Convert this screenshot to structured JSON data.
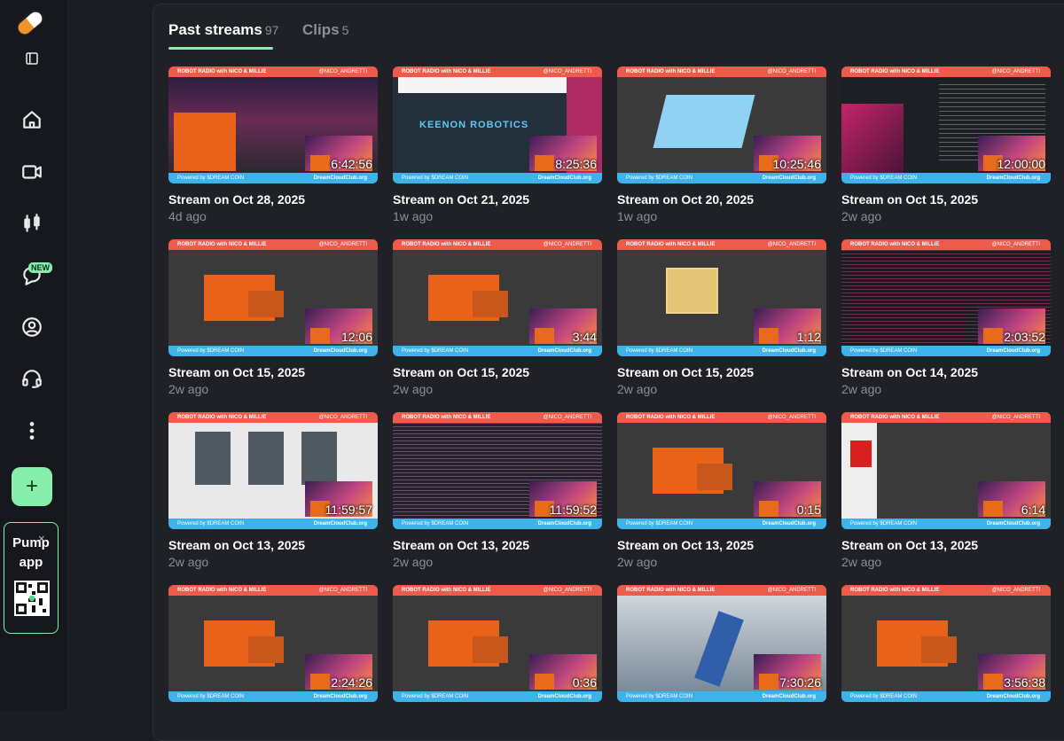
{
  "sidebar": {
    "items": [
      {
        "name": "sidebar-toggle-icon"
      },
      {
        "name": "home-icon"
      },
      {
        "name": "video-camera-icon"
      },
      {
        "name": "candlestick-icon"
      },
      {
        "name": "chat-icon",
        "badge": "NEW"
      },
      {
        "name": "profile-icon"
      },
      {
        "name": "headset-icon"
      },
      {
        "name": "more-icon"
      }
    ],
    "new_badge": "NEW",
    "plus_label": "+",
    "pump_app": {
      "line1": "Pump",
      "line2": "app",
      "close": "×"
    }
  },
  "tabs": [
    {
      "label": "Past streams",
      "count": "97",
      "active": true
    },
    {
      "label": "Clips",
      "count": "5",
      "active": false
    }
  ],
  "banner": {
    "top_left": "ROBOT RADIO with NICO & MILLIE",
    "top_right": "@NICO_ANDRETTI",
    "bottom_left": "Powered by $DREAM COIN",
    "bottom_right": "DreamCloudClub.org"
  },
  "streams": [
    {
      "title": "Stream on Oct 28, 2025",
      "age": "4d ago",
      "duration": "6:42:56",
      "scene": "studio"
    },
    {
      "title": "Stream on Oct 21, 2025",
      "age": "1w ago",
      "duration": "8:25:36",
      "scene": "web",
      "scene_text": "KEENON ROBOTICS"
    },
    {
      "title": "Stream on Oct 20, 2025",
      "age": "1w ago",
      "duration": "10:25:46",
      "scene": "cad"
    },
    {
      "title": "Stream on Oct 15, 2025",
      "age": "2w ago",
      "duration": "12:00:00",
      "scene": "code"
    },
    {
      "title": "Stream on Oct 15, 2025",
      "age": "2w ago",
      "duration": "12:06",
      "scene": "orange"
    },
    {
      "title": "Stream on Oct 15, 2025",
      "age": "2w ago",
      "duration": "3:44",
      "scene": "orange"
    },
    {
      "title": "Stream on Oct 15, 2025",
      "age": "2w ago",
      "duration": "1:12",
      "scene": "tan"
    },
    {
      "title": "Stream on Oct 14, 2025",
      "age": "2w ago",
      "duration": "2:03:52",
      "scene": "pro"
    },
    {
      "title": "Stream on Oct 13, 2025",
      "age": "2w ago",
      "duration": "11:59:57",
      "scene": "shop"
    },
    {
      "title": "Stream on Oct 13, 2025",
      "age": "2w ago",
      "duration": "11:59:52",
      "scene": "term"
    },
    {
      "title": "Stream on Oct 13, 2025",
      "age": "2w ago",
      "duration": "0:15",
      "scene": "orange"
    },
    {
      "title": "Stream on Oct 13, 2025",
      "age": "2w ago",
      "duration": "6:14",
      "scene": "red"
    },
    {
      "title": "",
      "age": "",
      "duration": "2:24:26",
      "scene": "orange"
    },
    {
      "title": "",
      "age": "",
      "duration": "0:36",
      "scene": "orange"
    },
    {
      "title": "",
      "age": "",
      "duration": "7:30:26",
      "scene": "robot"
    },
    {
      "title": "",
      "age": "",
      "duration": "3:56:38",
      "scene": "orange"
    }
  ],
  "colors": {
    "accent": "#86efac",
    "banner_red": "#ef5b4b",
    "banner_blue": "#3db3ea",
    "bg": "#1b1d22"
  }
}
